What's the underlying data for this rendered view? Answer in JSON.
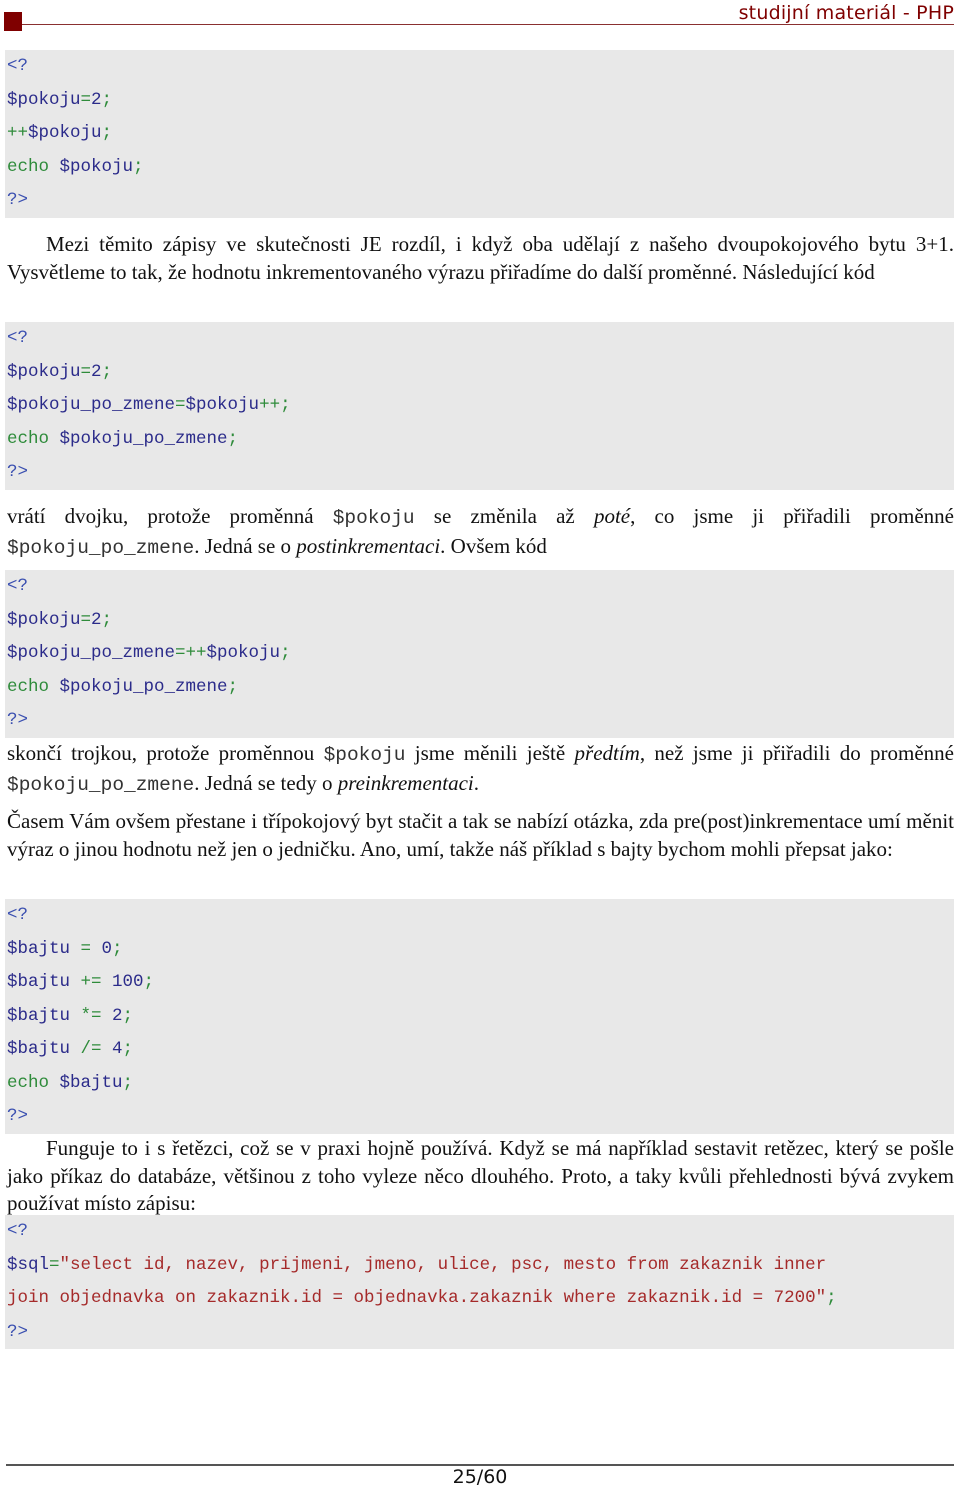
{
  "header": {
    "title": "studijní materiál - PHP",
    "accent_color": "#7f0000"
  },
  "code_block_1": {
    "lines": [
      [
        {
          "t": "tag",
          "v": "<?"
        }
      ],
      [
        {
          "t": "var",
          "v": "$pokoju"
        },
        {
          "t": "op",
          "v": "="
        },
        {
          "t": "num",
          "v": "2"
        },
        {
          "t": "op",
          "v": ";"
        }
      ],
      [
        {
          "t": "op",
          "v": "++"
        },
        {
          "t": "var",
          "v": "$pokoju"
        },
        {
          "t": "op",
          "v": ";"
        }
      ],
      [
        {
          "t": "kw",
          "v": "echo"
        },
        {
          "t": "var",
          "v": " $pokoju"
        },
        {
          "t": "op",
          "v": ";"
        }
      ],
      [
        {
          "t": "tag",
          "v": "?>"
        }
      ]
    ]
  },
  "para_1": {
    "text": "Mezi těmito zápisy ve skutečnosti JE rozdíl, i když oba udělají z našeho dvoupokojového bytu 3+1. Vysvětleme to tak, že hodnotu inkrementovaného výrazu přiřadíme do další proměnné. Následující kód"
  },
  "code_block_2": {
    "lines": [
      [
        {
          "t": "tag",
          "v": "<?"
        }
      ],
      [
        {
          "t": "var",
          "v": "$pokoju"
        },
        {
          "t": "op",
          "v": "="
        },
        {
          "t": "num",
          "v": "2"
        },
        {
          "t": "op",
          "v": ";"
        }
      ],
      [
        {
          "t": "var",
          "v": "$pokoju_po_zmene"
        },
        {
          "t": "op",
          "v": "="
        },
        {
          "t": "var",
          "v": "$pokoju"
        },
        {
          "t": "op",
          "v": "++;"
        }
      ],
      [
        {
          "t": "kw",
          "v": "echo"
        },
        {
          "t": "var",
          "v": " $pokoju_po_zmene"
        },
        {
          "t": "op",
          "v": ";"
        }
      ],
      [
        {
          "t": "tag",
          "v": "?>"
        }
      ]
    ]
  },
  "para_2": {
    "s1": "vrátí dvojku, protože proměnná ",
    "code1": "$pokoju",
    "s2": " se změnila až ",
    "em1": "poté",
    "s3": ", co jsme ji přiřadili proměnné ",
    "code2": "$pokoju_po_zmene",
    "s4": ". Jedná se o ",
    "em2": "postinkrementaci",
    "s5": ". Ovšem kód"
  },
  "code_block_3": {
    "lines": [
      [
        {
          "t": "tag",
          "v": "<?"
        }
      ],
      [
        {
          "t": "var",
          "v": "$pokoju"
        },
        {
          "t": "op",
          "v": "="
        },
        {
          "t": "num",
          "v": "2"
        },
        {
          "t": "op",
          "v": ";"
        }
      ],
      [
        {
          "t": "var",
          "v": "$pokoju_po_zmene"
        },
        {
          "t": "op",
          "v": "=++"
        },
        {
          "t": "var",
          "v": "$pokoju"
        },
        {
          "t": "op",
          "v": ";"
        }
      ],
      [
        {
          "t": "kw",
          "v": "echo"
        },
        {
          "t": "var",
          "v": " $pokoju_po_zmene"
        },
        {
          "t": "op",
          "v": ";"
        }
      ],
      [
        {
          "t": "tag",
          "v": "?>"
        }
      ]
    ]
  },
  "para_3": {
    "s1": "skončí trojkou, protože proměnnou ",
    "code1": "$pokoju",
    "s2": " jsme měnili ještě ",
    "em1": "předtím",
    "s3": ", než jsme ji přiřadili do proměnné ",
    "code2": "$pokoju_po_zmene",
    "s4": ". Jedná se tedy o ",
    "em2": "preinkrementaci",
    "s5": "."
  },
  "para_4": {
    "text": "Časem Vám ovšem přestane i třípokojový byt stačit a tak se nabízí otázka, zda pre(post)inkrementace umí měnit výraz o jinou hodnotu než jen o jedničku. Ano, umí, takže náš příklad s bajty bychom mohli přepsat jako:"
  },
  "code_block_4": {
    "lines": [
      [
        {
          "t": "tag",
          "v": "<?"
        }
      ],
      [
        {
          "t": "var",
          "v": "$bajtu "
        },
        {
          "t": "op",
          "v": "="
        },
        {
          "t": "num",
          "v": " 0"
        },
        {
          "t": "op",
          "v": ";"
        }
      ],
      [
        {
          "t": "var",
          "v": "$bajtu "
        },
        {
          "t": "op",
          "v": "+="
        },
        {
          "t": "num",
          "v": " 100"
        },
        {
          "t": "op",
          "v": ";"
        }
      ],
      [
        {
          "t": "var",
          "v": "$bajtu "
        },
        {
          "t": "op",
          "v": "*="
        },
        {
          "t": "num",
          "v": " 2"
        },
        {
          "t": "op",
          "v": ";"
        }
      ],
      [
        {
          "t": "var",
          "v": "$bajtu "
        },
        {
          "t": "op",
          "v": "/="
        },
        {
          "t": "num",
          "v": " 4"
        },
        {
          "t": "op",
          "v": ";"
        }
      ],
      [
        {
          "t": "kw",
          "v": "echo"
        },
        {
          "t": "var",
          "v": " $bajtu"
        },
        {
          "t": "op",
          "v": ";"
        }
      ],
      [
        {
          "t": "tag",
          "v": "?>"
        }
      ]
    ]
  },
  "para_5": {
    "text": "Funguje to i s řetězci, což se v praxi hojně používá. Když se má například sestavit retězec, který se pošle jako příkaz do databáze, většinou z toho vyleze něco dlouhého. Proto, a taky kvůli přehlednosti bývá zvykem používat místo zápisu:"
  },
  "code_block_5": {
    "lines": [
      [
        {
          "t": "tag",
          "v": "<?"
        }
      ],
      [
        {
          "t": "var",
          "v": "$sql"
        },
        {
          "t": "op",
          "v": "="
        },
        {
          "t": "str",
          "v": "\"select id, nazev, prijmeni, jmeno, ulice, psc, mesto from zakaznik inner"
        }
      ],
      [
        {
          "t": "str",
          "v": "join objednavka on zakaznik.id = objednavka.zakaznik where zakaznik.id = 7200\""
        },
        {
          "t": "op",
          "v": ";"
        }
      ],
      [
        {
          "t": "tag",
          "v": "?>"
        }
      ]
    ]
  },
  "footer": {
    "page_number": "25/60"
  },
  "syntax_colors": {
    "tag": "#3a4fb0",
    "variable": "#2b2b8a",
    "operator": "#2e8b3a",
    "keyword": "#2e8b3a",
    "string": "#a52a2a",
    "code_background": "#e8e8e8"
  }
}
